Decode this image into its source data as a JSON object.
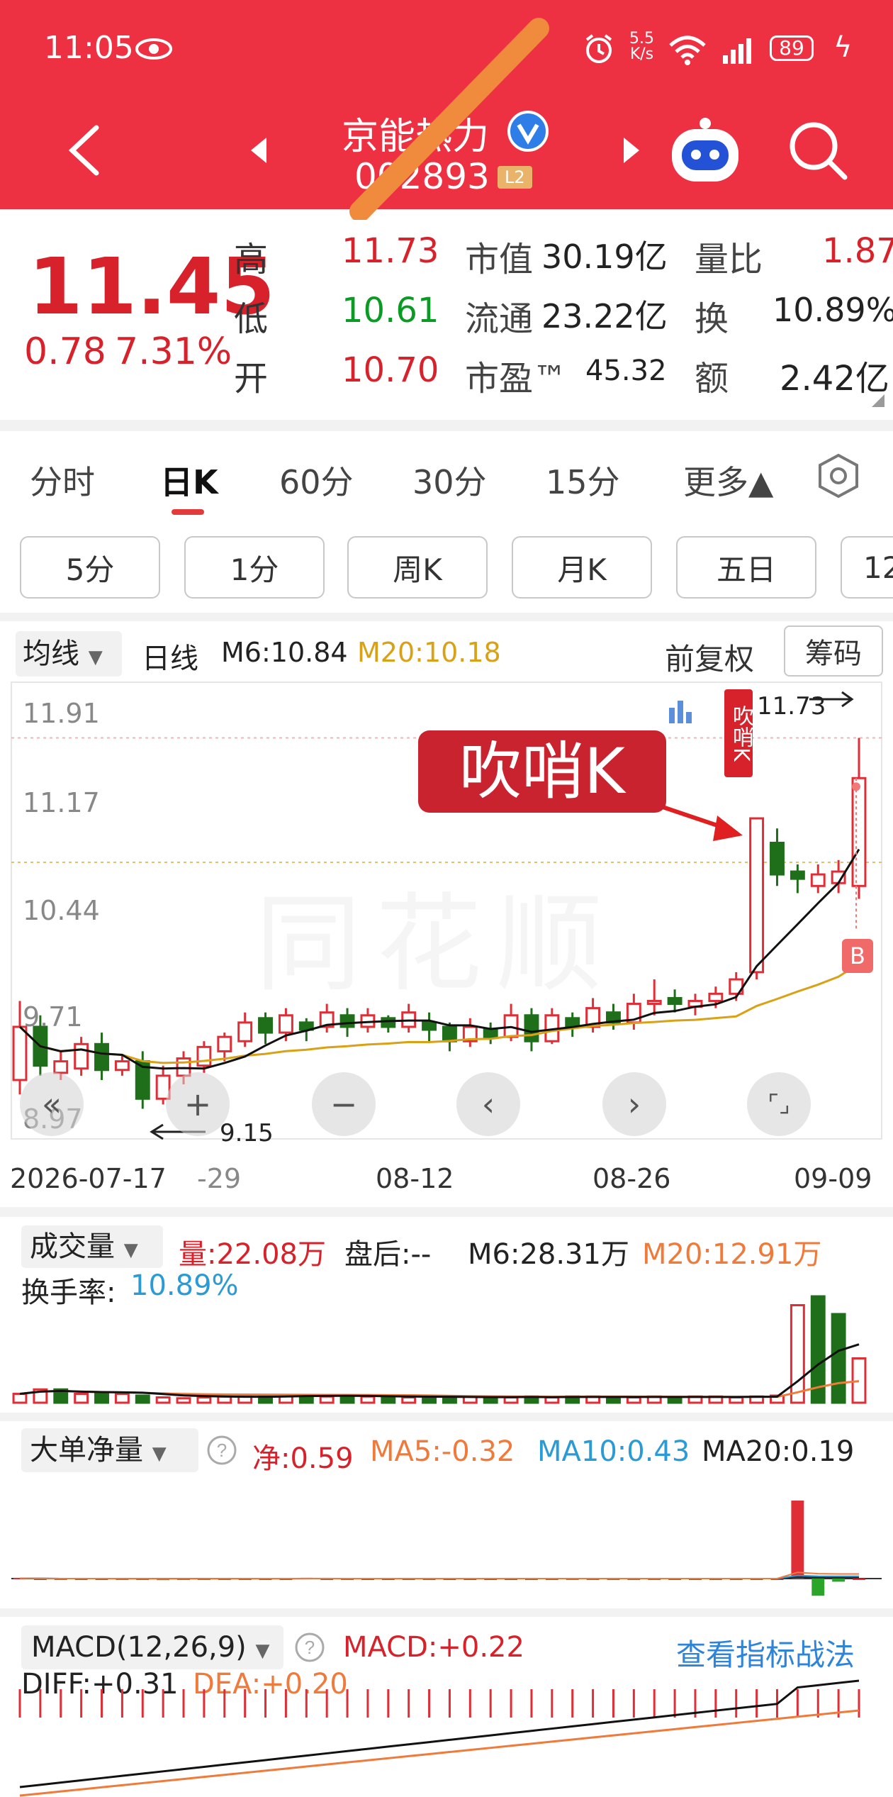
{
  "status_bar": {
    "time": "11:05",
    "net_speed_top": "5.5",
    "net_speed_unit": "K/s",
    "battery": "89"
  },
  "header": {
    "title": "京能热力",
    "code": "002893",
    "level_badge": "L2"
  },
  "quote": {
    "price": "11.45",
    "change": "0.78",
    "change_pct": "7.31%",
    "rows": [
      {
        "l1": "高",
        "v1": "11.73",
        "l2": "市值",
        "v2": "30.19亿",
        "l3": "量比",
        "v3": "1.87"
      },
      {
        "l1": "低",
        "v1": "10.61",
        "l2": "流通",
        "v2": "23.22亿",
        "l3": "换",
        "v3": "10.89%"
      },
      {
        "l1": "开",
        "v1": "10.70",
        "l2": "市盈™",
        "v2": "45.32",
        "l3": "额",
        "v3": "2.42亿"
      }
    ]
  },
  "tabs": [
    "分时",
    "日K",
    "60分",
    "30分",
    "15分",
    "更多▲"
  ],
  "active_tab": "日K",
  "periods": [
    "5分",
    "1分",
    "周K",
    "月K",
    "五日",
    "12"
  ],
  "kline_bar": {
    "indicator": "均线",
    "line_type": "日线",
    "m6": "M6:10.84",
    "m20": "M20:10.18",
    "adjust": "前复权",
    "chips": "筹码"
  },
  "kline": {
    "y_labels": [
      "11.91",
      "11.17",
      "10.44",
      "9.71",
      "8.97"
    ],
    "high_label": "11.73",
    "low_label": "9.15",
    "whistle_tag": "吹哨K",
    "annotation": "吹哨K",
    "b_marker": "B",
    "x_labels": [
      "2026-07-17",
      "-29",
      "08-12",
      "08-26",
      "09-09"
    ],
    "watermark": "同花顺",
    "colors": {
      "up": "#e02e36",
      "down": "#1f6f1a",
      "m6": "#111111",
      "m20": "#d9a116"
    }
  },
  "chart_data": {
    "type": "candlestick",
    "ohlc": [
      [
        9.35,
        9.72,
        9.25,
        9.9
      ],
      [
        9.72,
        9.45,
        9.38,
        9.8
      ],
      [
        9.4,
        9.48,
        9.35,
        9.55
      ],
      [
        9.43,
        9.6,
        9.38,
        9.65
      ],
      [
        9.6,
        9.42,
        9.35,
        9.68
      ],
      [
        9.42,
        9.48,
        9.38,
        9.52
      ],
      [
        9.48,
        9.22,
        9.15,
        9.55
      ],
      [
        9.22,
        9.38,
        9.18,
        9.45
      ],
      [
        9.38,
        9.5,
        9.32,
        9.55
      ],
      [
        9.45,
        9.58,
        9.4,
        9.62
      ],
      [
        9.55,
        9.65,
        9.48,
        9.68
      ],
      [
        9.62,
        9.75,
        9.58,
        9.82
      ],
      [
        9.78,
        9.68,
        9.6,
        9.82
      ],
      [
        9.68,
        9.8,
        9.62,
        9.85
      ],
      [
        9.75,
        9.7,
        9.62,
        9.78
      ],
      [
        9.72,
        9.82,
        9.68,
        9.88
      ],
      [
        9.8,
        9.72,
        9.65,
        9.85
      ],
      [
        9.72,
        9.8,
        9.68,
        9.85
      ],
      [
        9.78,
        9.72,
        9.68,
        9.8
      ],
      [
        9.72,
        9.82,
        9.68,
        9.88
      ],
      [
        9.75,
        9.7,
        9.62,
        9.82
      ],
      [
        9.72,
        9.62,
        9.55,
        9.75
      ],
      [
        9.62,
        9.72,
        9.58,
        9.78
      ],
      [
        9.7,
        9.65,
        9.6,
        9.75
      ],
      [
        9.65,
        9.8,
        9.62,
        9.88
      ],
      [
        9.8,
        9.62,
        9.55,
        9.85
      ],
      [
        9.62,
        9.8,
        9.6,
        9.85
      ],
      [
        9.78,
        9.72,
        9.65,
        9.82
      ],
      [
        9.72,
        9.85,
        9.68,
        9.92
      ],
      [
        9.82,
        9.75,
        9.7,
        9.88
      ],
      [
        9.75,
        9.88,
        9.7,
        9.95
      ],
      [
        9.88,
        9.9,
        9.8,
        10.05
      ],
      [
        9.92,
        9.88,
        9.82,
        9.98
      ],
      [
        9.86,
        9.9,
        9.8,
        9.95
      ],
      [
        9.9,
        9.95,
        9.85,
        10.0
      ],
      [
        9.95,
        10.05,
        9.9,
        10.1
      ],
      [
        10.1,
        11.17,
        10.05,
        11.17
      ],
      [
        11.0,
        10.78,
        10.7,
        11.1
      ],
      [
        10.8,
        10.75,
        10.65,
        10.85
      ],
      [
        10.7,
        10.78,
        10.65,
        10.85
      ],
      [
        10.72,
        10.8,
        10.65,
        10.88
      ],
      [
        10.7,
        11.45,
        10.61,
        11.73
      ]
    ],
    "ma6_label": "M6:10.84",
    "ma20_label": "M20:10.18",
    "volume": [
      1.0,
      1.5,
      1.5,
      1.0,
      1.0,
      1.0,
      0.8,
      0.6,
      0.5,
      0.6,
      0.7,
      0.8,
      0.8,
      0.8,
      0.8,
      0.7,
      0.8,
      0.7,
      0.6,
      0.6,
      0.7,
      0.6,
      0.7,
      0.6,
      0.6,
      0.7,
      0.6,
      0.7,
      0.7,
      0.6,
      0.6,
      0.7,
      0.6,
      0.7,
      0.7,
      0.6,
      0.7,
      0.8,
      11.0,
      12.0,
      10.0,
      5.0
    ],
    "volume_up": [
      true,
      true,
      false,
      true,
      false,
      true,
      false,
      true,
      true,
      true,
      true,
      true,
      false,
      true,
      false,
      true,
      false,
      true,
      false,
      true,
      false,
      false,
      true,
      false,
      true,
      false,
      true,
      false,
      true,
      false,
      true,
      true,
      false,
      true,
      true,
      true,
      true,
      true,
      true,
      false,
      false,
      true
    ],
    "net_flow": [
      0.01,
      0.0,
      -0.01,
      0.0,
      0.0,
      -0.01,
      0.0,
      -0.02,
      0.0,
      0.0,
      0.0,
      0.0,
      0.0,
      0.0,
      0.01,
      0.0,
      -0.01,
      0.0,
      0.0,
      0.0,
      0.0,
      0.0,
      0.0,
      0.0,
      0.0,
      0.0,
      0.0,
      -0.01,
      0.0,
      0.0,
      0.0,
      0.0,
      0.0,
      0.0,
      0.0,
      0.0,
      0.0,
      0.0,
      1.0,
      -0.22,
      -0.04,
      0.0,
      0.05
    ]
  },
  "volume_panel": {
    "indicator": "成交量",
    "vol": "量:22.08万",
    "after": "盘后:-- ",
    "m6": "M6:28.31万",
    "m20": "M20:12.91万",
    "turnover_label": "换手率:",
    "turnover": "10.89%"
  },
  "flow_panel": {
    "indicator": "大单净量",
    "net": "净:0.59",
    "ma5": "MA5:-0.32",
    "ma10": "MA10:0.43",
    "ma20": "MA20:0.19"
  },
  "macd_panel": {
    "indicator": "MACD(12,26,9)",
    "macd": "MACD:+0.22",
    "link": "查看指标战法",
    "diff": "DIFF:+0.31",
    "dea": "DEA:+0.20"
  }
}
